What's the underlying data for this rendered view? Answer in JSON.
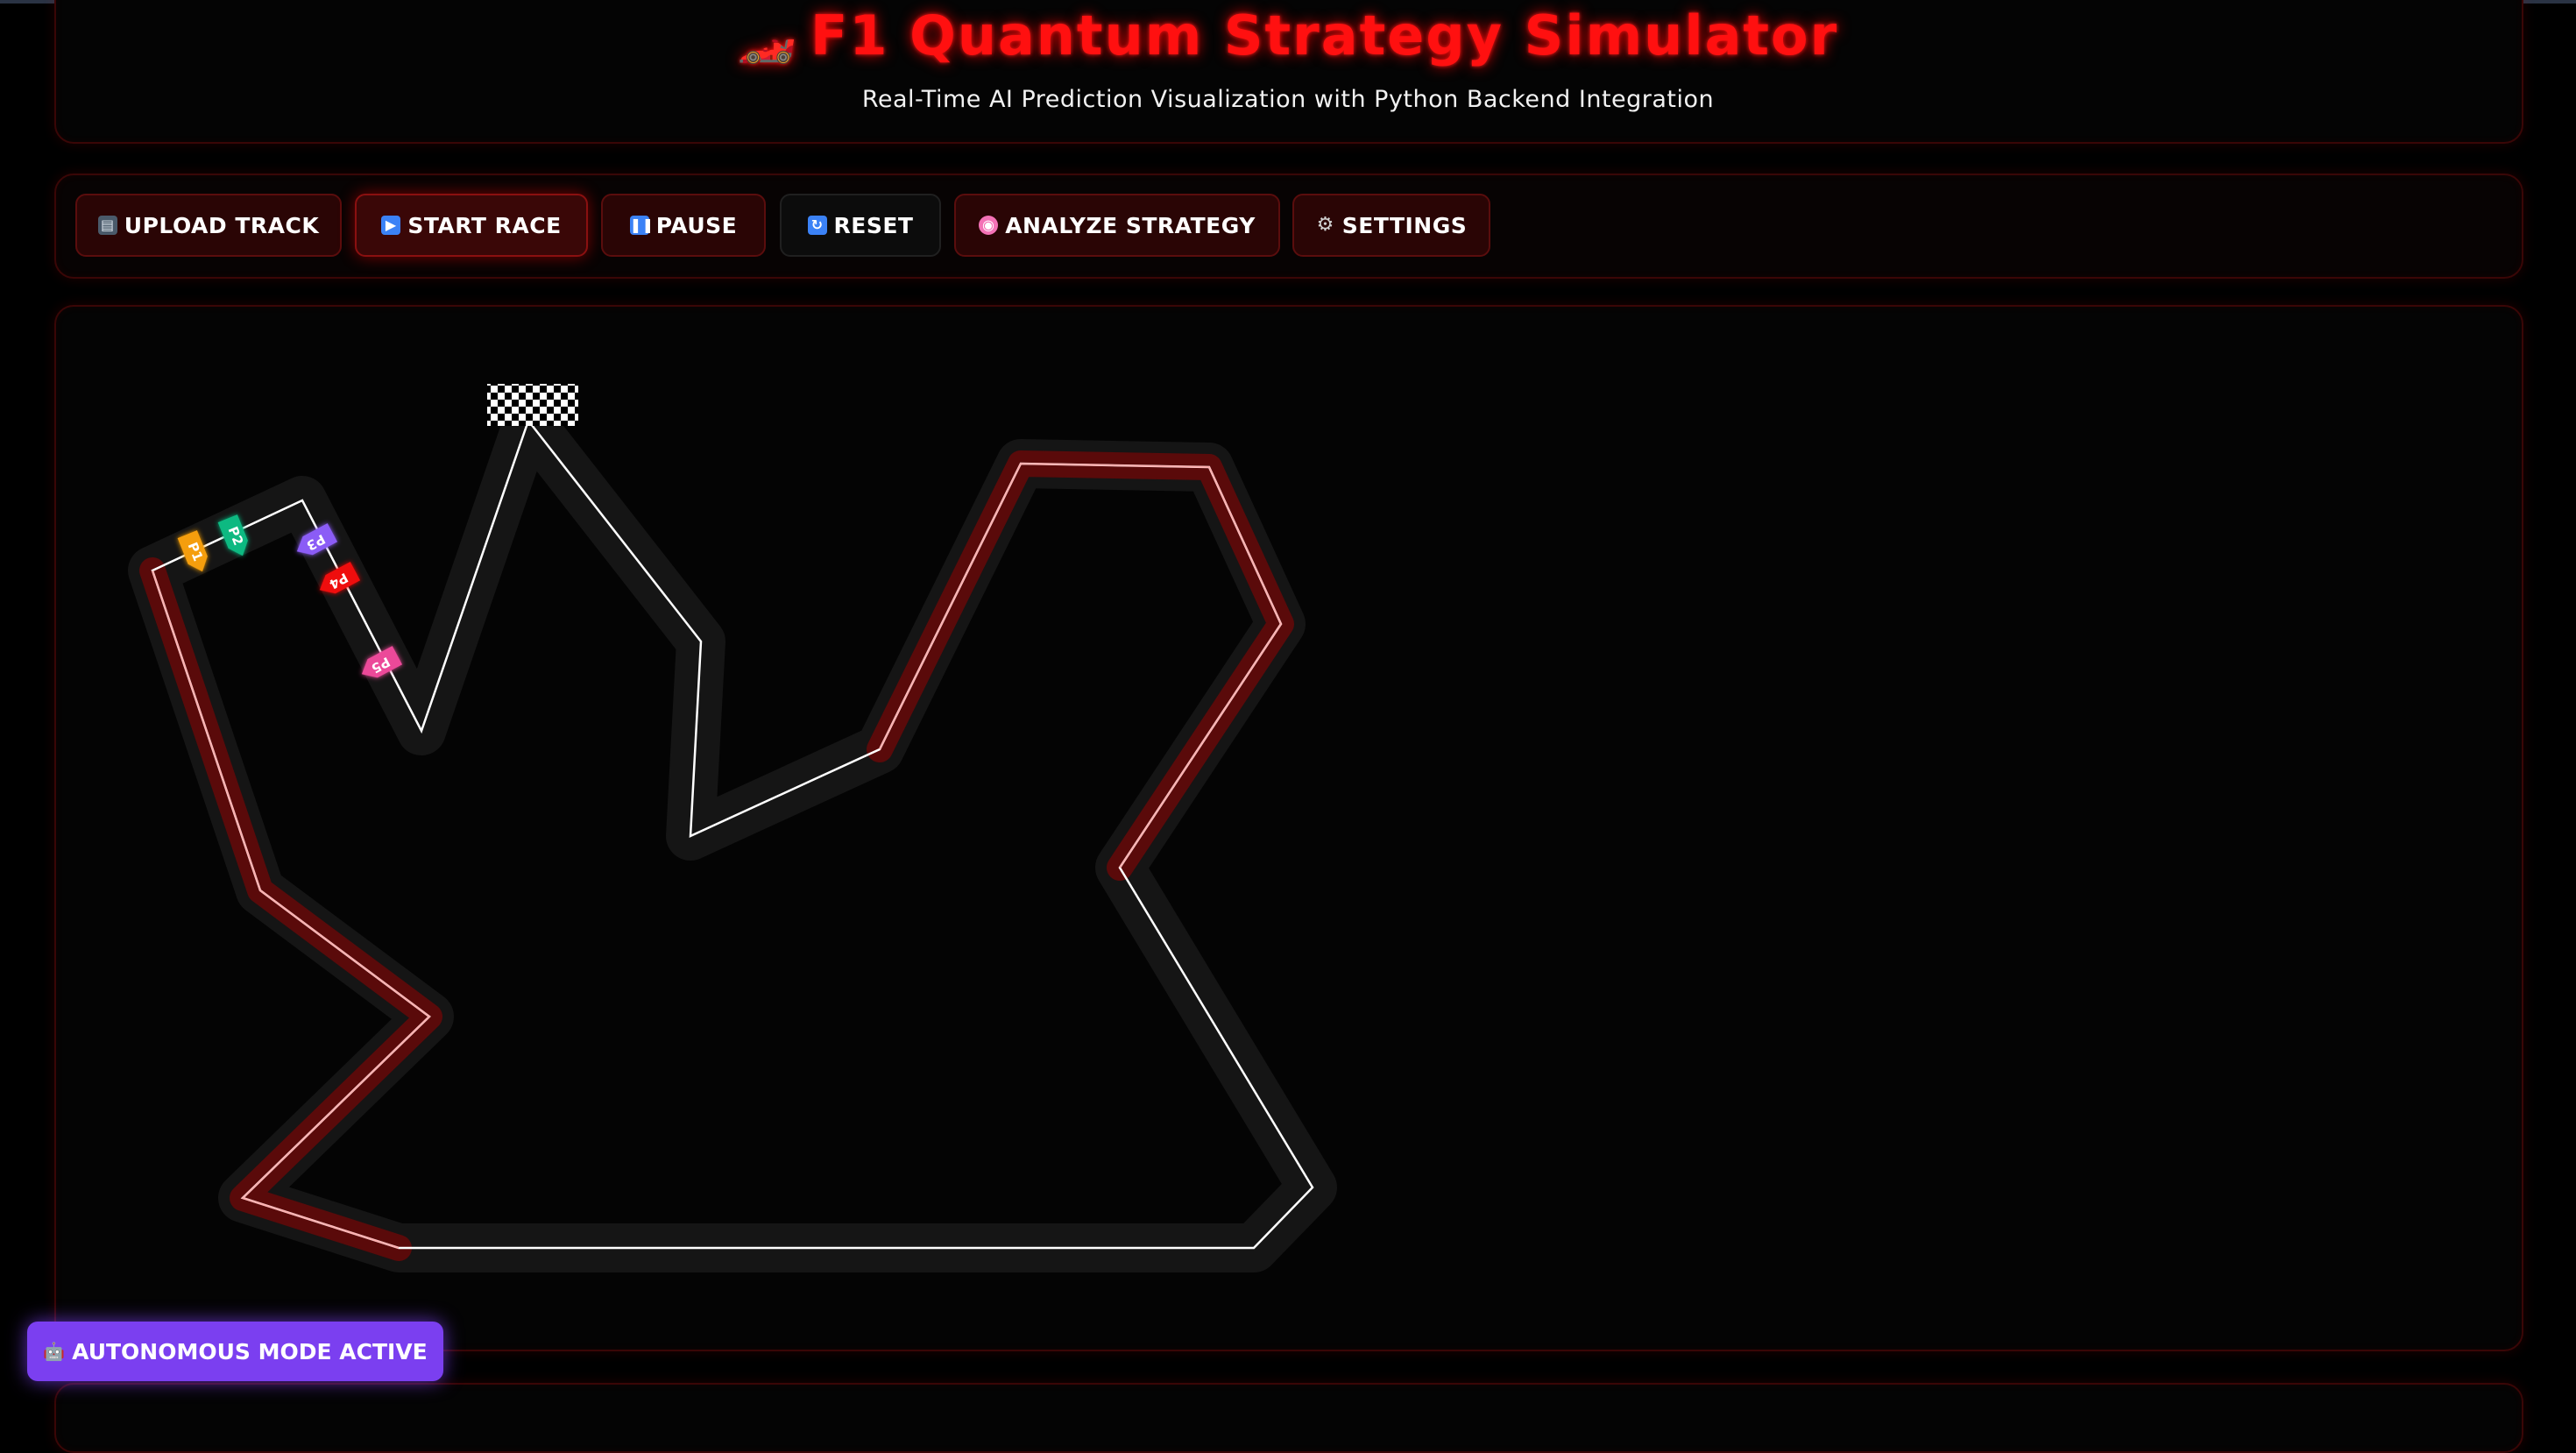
{
  "header": {
    "title": "F1 Quantum Strategy Simulator",
    "title_icon": "race-car-icon",
    "subtitle": "Real-Time AI Prediction Visualization with Python Backend Integration"
  },
  "controls": {
    "upload_label": "UPLOAD TRACK",
    "start_label": "START RACE",
    "pause_label": "PAUSE",
    "reset_label": "RESET",
    "analyze_label": "ANALYZE STRATEGY",
    "settings_label": "SETTINGS"
  },
  "cars": [
    {
      "label": "P1",
      "color": "#f59e0b"
    },
    {
      "label": "P2",
      "color": "#10b981"
    },
    {
      "label": "P3",
      "color": "#8b5cf6"
    },
    {
      "label": "P4",
      "color": "#ef1111"
    },
    {
      "label": "P5",
      "color": "#ec4899"
    }
  ],
  "status": {
    "mode_label": "AUTONOMOUS MODE ACTIVE"
  },
  "colors": {
    "accent": "#ff1010",
    "badge": "#7b3ff0",
    "track_surface": "#151515",
    "track_highlight": "#5a0a0a"
  }
}
